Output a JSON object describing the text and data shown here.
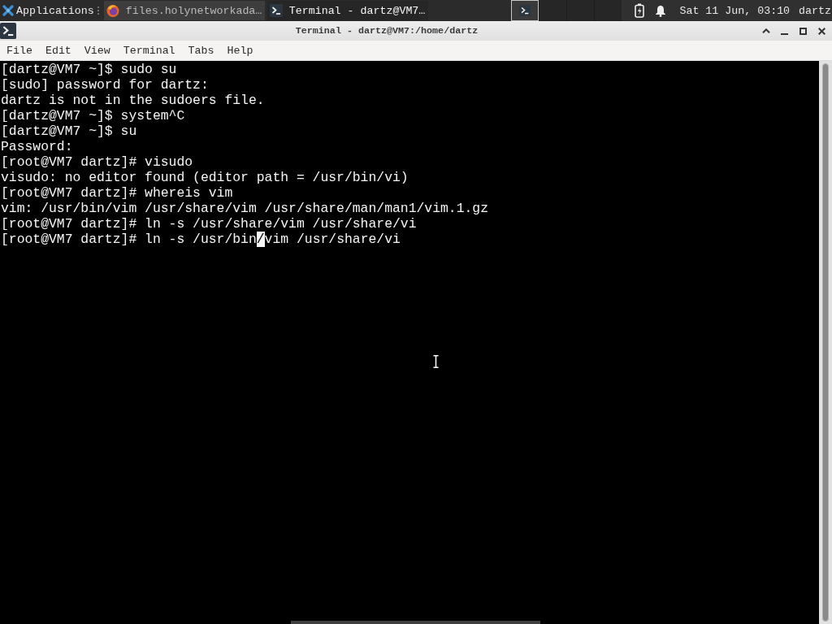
{
  "top_panel": {
    "applications_label": "Applications",
    "tasks": [
      {
        "kind": "browser",
        "label": "files.holynetworkada…",
        "selected": false
      },
      {
        "kind": "terminal",
        "label": "Terminal - dartz@VM7…",
        "selected": true
      }
    ],
    "workspaces": [
      {
        "selected": true
      },
      {
        "selected": false
      },
      {
        "selected": false
      },
      {
        "selected": false
      }
    ],
    "clock": "Sat 11 Jun, 03:10",
    "user": "dartz"
  },
  "window": {
    "title": "Terminal - dartz@VM7:/home/dartz"
  },
  "menu_bar": [
    "File",
    "Edit",
    "View",
    "Terminal",
    "Tabs",
    "Help"
  ],
  "terminal": {
    "lines": [
      "[dartz@VM7 ~]$ sudo su",
      "[sudo] password for dartz:",
      "dartz is not in the sudoers file.",
      "[dartz@VM7 ~]$ system^C",
      "[dartz@VM7 ~]$ su",
      "Password:",
      "[root@VM7 dartz]# visudo",
      "visudo: no editor found (editor path = /usr/bin/vi)",
      "[root@VM7 dartz]# whereis vim",
      "vim: /usr/bin/vim /usr/share/vim /usr/share/man/man1/vim.1.gz",
      "[root@VM7 dartz]# ln -s /usr/share/vim /usr/share/vi"
    ],
    "cursor_line": {
      "before": "[root@VM7 dartz]# ln -s /usr/bin",
      "cursor": "/",
      "after": "vim /usr/share/vi"
    }
  }
}
